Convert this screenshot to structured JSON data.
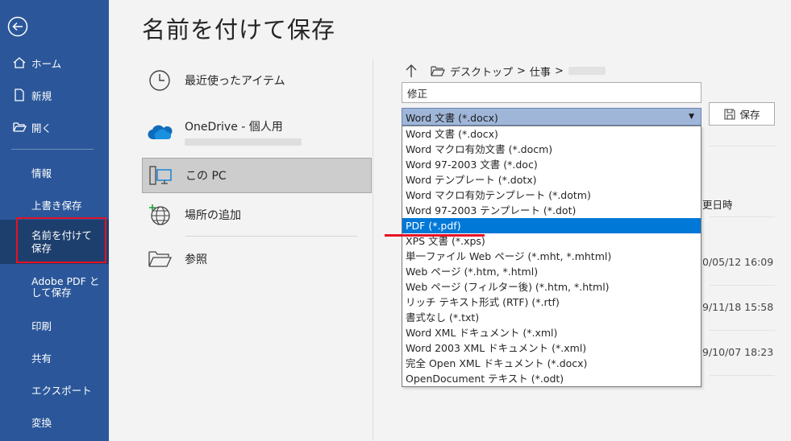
{
  "sidebar": {
    "items": [
      {
        "label": "ホーム"
      },
      {
        "label": "新規"
      },
      {
        "label": "開く"
      },
      {
        "label": "情報"
      },
      {
        "label": "上書き保存"
      },
      {
        "label": "名前を付けて保存"
      },
      {
        "label": "Adobe PDF として保存"
      },
      {
        "label": "印刷"
      },
      {
        "label": "共有"
      },
      {
        "label": "エクスポート"
      },
      {
        "label": "変換"
      }
    ],
    "selected": "名前を付けて保存"
  },
  "page": {
    "title": "名前を付けて保存"
  },
  "locations": [
    {
      "label": "最近使ったアイテム",
      "icon": "clock-icon"
    },
    {
      "label": "OneDrive - 個人用",
      "icon": "cloud-icon"
    },
    {
      "label": "この PC",
      "icon": "pc-icon"
    },
    {
      "label": "場所の追加",
      "icon": "globe-add-icon"
    },
    {
      "label": "参照",
      "icon": "folder-icon"
    }
  ],
  "path": {
    "segments": [
      "デスクトップ",
      ">",
      "仕事",
      ">"
    ]
  },
  "filename": {
    "value": "修正"
  },
  "filetype": {
    "selected": "Word 文書 (*.docx)"
  },
  "save_button": {
    "label": "保存"
  },
  "file_list": {
    "modified_header": "更日時",
    "dates": [
      "0/05/12 16:09",
      "9/11/18 15:58",
      "9/10/07 18:23"
    ]
  },
  "dropdown": {
    "options": [
      "Word 文書 (*.docx)",
      "Word マクロ有効文書 (*.docm)",
      "Word 97-2003 文書 (*.doc)",
      "Word テンプレート (*.dotx)",
      "Word マクロ有効テンプレート (*.dotm)",
      "Word 97-2003 テンプレート (*.dot)",
      "PDF (*.pdf)",
      "XPS 文書 (*.xps)",
      "単一ファイル Web ページ (*.mht, *.mhtml)",
      "Web ページ (*.htm, *.html)",
      "Web ページ (フィルター後) (*.htm, *.html)",
      "リッチ テキスト形式 (RTF) (*.rtf)",
      "書式なし (*.txt)",
      "Word XML ドキュメント (*.xml)",
      "Word 2003 XML ドキュメント (*.xml)",
      "完全 Open XML ドキュメント (*.docx)",
      "OpenDocument テキスト (*.odt)"
    ],
    "highlighted": "PDF (*.pdf)"
  },
  "colors": {
    "sidebar": "#2b579a",
    "sidebar_selected": "#1d3f6e",
    "highlight": "#0078d7",
    "annotation_red": "#e81123"
  }
}
